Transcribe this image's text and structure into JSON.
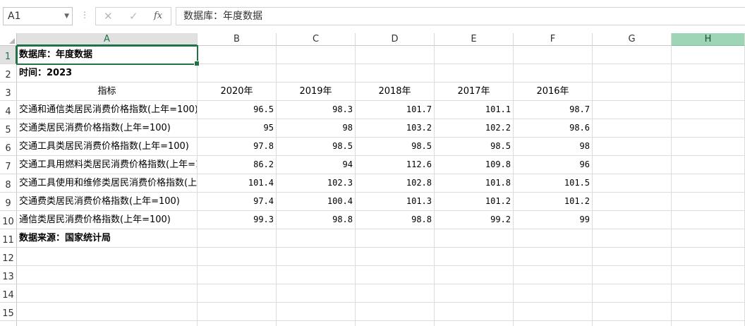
{
  "name_box": "A1",
  "formula_bar": {
    "content": "数据库：年度数据",
    "cancel_icon": "x-icon",
    "enter_icon": "check-icon",
    "fx_label": "fx"
  },
  "columns": [
    "A",
    "B",
    "C",
    "D",
    "E",
    "F",
    "G",
    "H"
  ],
  "rows": [
    "1",
    "2",
    "3",
    "4",
    "5",
    "6",
    "7",
    "8",
    "9",
    "10",
    "11",
    "12",
    "13",
    "14",
    "15"
  ],
  "cells": {
    "r1": {
      "a": "数据库：年度数据"
    },
    "r2": {
      "a": "时间：2023"
    },
    "r3": {
      "a": "指标",
      "b": "2020年",
      "c": "2019年",
      "d": "2018年",
      "e": "2017年",
      "f": "2016年"
    },
    "r4": {
      "a": "交通和通信类居民消费价格指数(上年=100)",
      "b": "96.5",
      "c": "98.3",
      "d": "101.7",
      "e": "101.1",
      "f": "98.7"
    },
    "r5": {
      "a": "交通类居民消费价格指数(上年=100)",
      "b": "95",
      "c": "98",
      "d": "103.2",
      "e": "102.2",
      "f": "98.6"
    },
    "r6": {
      "a": "交通工具类居民消费价格指数(上年=100)",
      "b": "97.8",
      "c": "98.5",
      "d": "98.5",
      "e": "98.5",
      "f": "98"
    },
    "r7": {
      "a": "交通工具用燃料类居民消费价格指数(上年=1",
      "b": "86.2",
      "c": "94",
      "d": "112.6",
      "e": "109.8",
      "f": "96"
    },
    "r8": {
      "a": "交通工具使用和维修类居民消费价格指数(上年",
      "b": "101.4",
      "c": "102.3",
      "d": "102.8",
      "e": "101.8",
      "f": "101.5"
    },
    "r9": {
      "a": "交通费类居民消费价格指数(上年=100)",
      "b": "97.4",
      "c": "100.4",
      "d": "101.3",
      "e": "101.2",
      "f": "101.2"
    },
    "r10": {
      "a": "通信类居民消费价格指数(上年=100)",
      "b": "99.3",
      "c": "98.8",
      "d": "98.8",
      "e": "99.2",
      "f": "99"
    },
    "r11": {
      "a": "数据来源：国家统计局"
    }
  },
  "colors": {
    "accent": "#217346",
    "highlight_header": "#9fd5b7"
  }
}
